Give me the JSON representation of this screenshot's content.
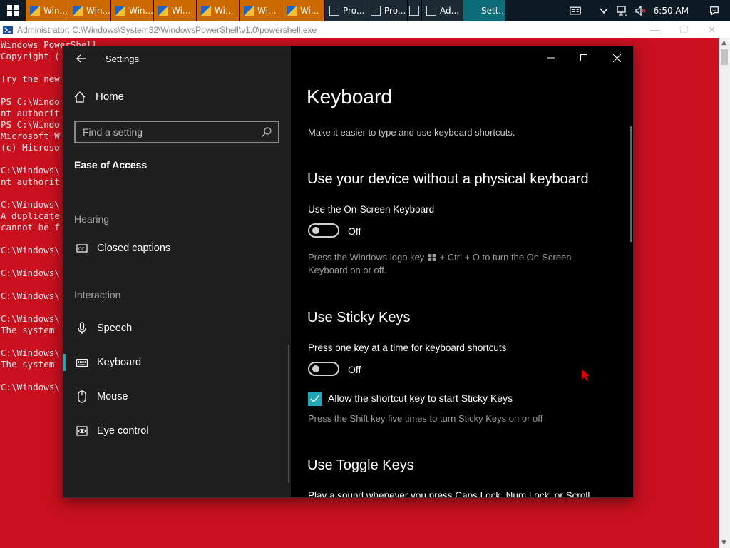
{
  "taskbar": {
    "buttons": [
      {
        "label": "Win...",
        "style": "orange"
      },
      {
        "label": "Win...",
        "style": "orange"
      },
      {
        "label": "Win...",
        "style": "orange"
      },
      {
        "label": "Wi...",
        "style": "orange"
      },
      {
        "label": "Wi...",
        "style": "orange"
      },
      {
        "label": "Wi...",
        "style": "orange"
      },
      {
        "label": "Wi...",
        "style": "orange"
      },
      {
        "label": "Pro...",
        "style": "dark"
      },
      {
        "label": "Pro...",
        "style": "dark"
      },
      {
        "label": "",
        "style": "small"
      },
      {
        "label": "Ad...",
        "style": "dark"
      },
      {
        "label": "Sett...",
        "style": "active"
      }
    ],
    "clock": "6:50 AM"
  },
  "powershell": {
    "title": "Administrator: C:\\Windows\\System32\\WindowsPowerShell\\v1.0\\powershell.exe",
    "lines": [
      "Windows PowerShell",
      "Copyright (",
      "",
      "Try the new",
      "",
      "PS C:\\Windo",
      "nt authorit",
      "PS C:\\Windo",
      "Microsoft W",
      "(c) Microso",
      "",
      "C:\\Windows\\",
      "nt authorit",
      "",
      "C:\\Windows\\",
      "A duplicate",
      "cannot be f",
      "",
      "C:\\Windows\\",
      "",
      "C:\\Windows\\",
      "",
      "C:\\Windows\\",
      "",
      "C:\\Windows\\",
      "The system",
      "",
      "C:\\Windows\\",
      "The system",
      "",
      "C:\\Windows\\"
    ]
  },
  "settings": {
    "title": "Settings",
    "home_label": "Home",
    "search_placeholder": "Find a setting",
    "section": "Ease of Access",
    "groups": {
      "hearing": "Hearing",
      "interaction": "Interaction"
    },
    "nav": {
      "closed_captions": "Closed captions",
      "speech": "Speech",
      "keyboard": "Keyboard",
      "mouse": "Mouse",
      "eye_control": "Eye control"
    },
    "page": {
      "title": "Keyboard",
      "description": "Make it easier to type and use keyboard shortcuts.",
      "osk": {
        "heading": "Use your device without a physical keyboard",
        "label": "Use the On-Screen Keyboard",
        "state": "Off",
        "help_a": "Press the Windows logo key",
        "help_b": "+ Ctrl + O to turn the On-Screen Keyboard on or off."
      },
      "sticky": {
        "heading": "Use Sticky Keys",
        "label": "Press one key at a time for keyboard shortcuts",
        "state": "Off",
        "checkbox_label": "Allow the shortcut key to start Sticky Keys",
        "checkbox_checked": true,
        "help": "Press the Shift key five times to turn Sticky Keys on or off"
      },
      "toggle_keys": {
        "heading": "Use Toggle Keys",
        "label_partial": "Play a sound whenever you press Caps Lock, Num Lock, or Scroll"
      }
    }
  },
  "colors": {
    "desktop_red": "#c8101e",
    "accent": "#1fa8b6",
    "taskbar_orange": "#cc6a00"
  }
}
